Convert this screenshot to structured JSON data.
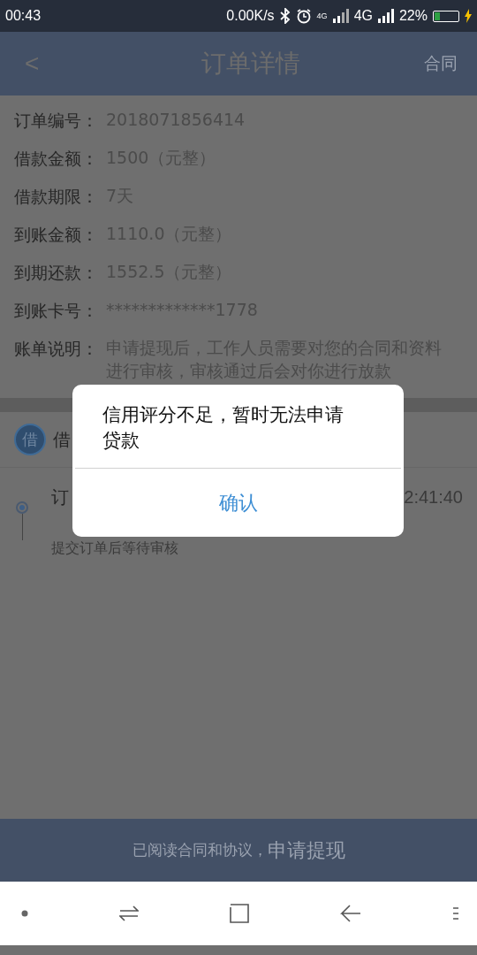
{
  "status_bar": {
    "time": "00:43",
    "speed": "0.00K/s",
    "network_small": "4G",
    "network": "4G",
    "battery": "22%"
  },
  "header": {
    "back": "<",
    "title": "订单详情",
    "action": "合同"
  },
  "details": [
    {
      "label": "订单编号：",
      "value": "2018071856414"
    },
    {
      "label": "借款金额：",
      "value": "1500（元整）"
    },
    {
      "label": "借款期限：",
      "value": "7天"
    },
    {
      "label": "到账金额：",
      "value": "1110.0（元整）"
    },
    {
      "label": "到期还款：",
      "value": "1552.5（元整）"
    },
    {
      "label": "到账卡号：",
      "value": "*************1778"
    },
    {
      "label": "账单说明：",
      "value": "申请提现后，工作人员需要对您的合同和资料进行审核，审核通过后会对你进行放款"
    }
  ],
  "section": {
    "badge": "借",
    "title": "借"
  },
  "timeline": [
    {
      "title": "订",
      "time": "2:41:40",
      "note": "提交订单后等待审核",
      "selected": true
    }
  ],
  "submit": {
    "note": "已阅读合同和协议，",
    "label": "申请提现"
  },
  "dialog": {
    "message": "信用评分不足，暂时无法申请贷款",
    "confirm": "确认"
  }
}
